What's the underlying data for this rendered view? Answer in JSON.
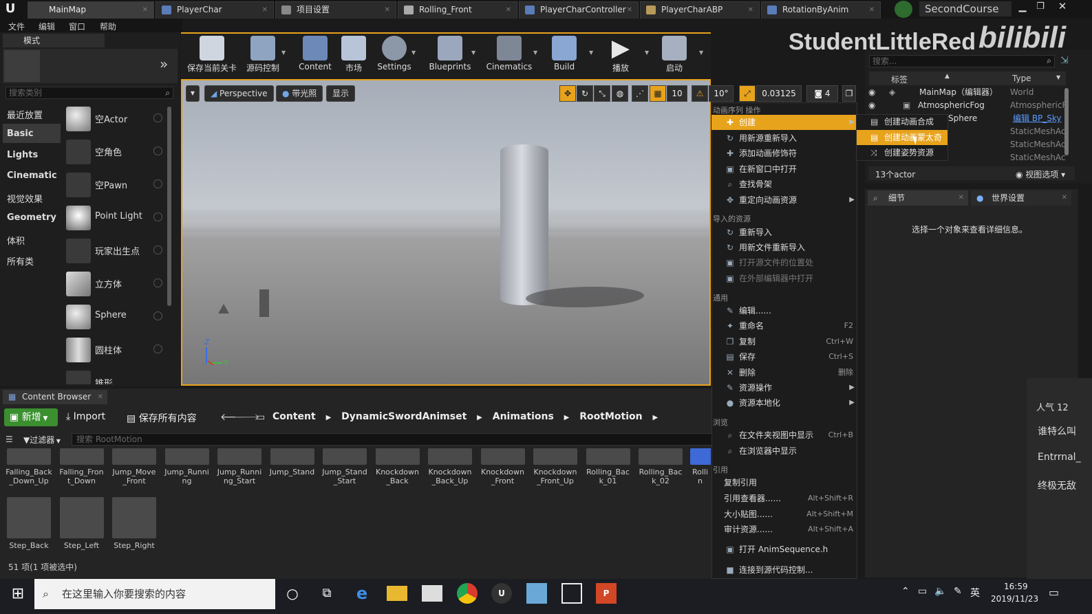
{
  "titlebar": {
    "tabs": [
      {
        "label": "MainMap"
      },
      {
        "label": "PlayerChar"
      },
      {
        "label": "项目设置"
      },
      {
        "label": "Rolling_Front"
      },
      {
        "label": "PlayerCharController"
      },
      {
        "label": "PlayerCharABP"
      },
      {
        "label": "RotationByAnim"
      }
    ],
    "project": "SecondCourse"
  },
  "menubar": [
    "文件",
    "编辑",
    "窗口",
    "帮助"
  ],
  "modes": {
    "title": "模式",
    "search_placeholder": "搜索类别",
    "categories": [
      "最近放置",
      "Basic",
      "Lights",
      "Cinematic",
      "视觉效果",
      "Geometry",
      "体积",
      "所有类"
    ],
    "actors": [
      "空Actor",
      "空角色",
      "空Pawn",
      "Point Light",
      "玩家出生点",
      "立方体",
      "Sphere",
      "圆柱体",
      "锥形"
    ]
  },
  "toolbar": {
    "buttons": [
      "保存当前关卡",
      "源码控制",
      "Content",
      "市场",
      "Settings",
      "Blueprints",
      "Cinematics",
      "Build",
      "播放",
      "启动"
    ]
  },
  "watermark": {
    "text": "StudentLittleRed",
    "logo": "bilibili"
  },
  "viewport": {
    "perspective": "Perspective",
    "lit": "带光照",
    "show": "显示",
    "grid_snap": "10",
    "rot_snap": "10°",
    "scale_snap": "0.03125",
    "cam_speed": "4",
    "axis_z": "Z",
    "axis_y": "Y"
  },
  "context_menu": {
    "sections": {
      "anim": "动画序列 操作",
      "imported": "导入的资源",
      "common": "通用",
      "browse": "浏览",
      "refs": "引用"
    },
    "items": [
      {
        "label": "创建",
        "icon": "✚",
        "arrow": "▶"
      },
      {
        "label": "用新源重新导入",
        "icon": "↻"
      },
      {
        "label": "添加动画修饰符",
        "icon": "✚"
      },
      {
        "label": "在新窗口中打开",
        "icon": "▣"
      },
      {
        "label": "查找骨架",
        "icon": "⌕"
      },
      {
        "label": "重定向动画资源",
        "icon": "✥",
        "arrow": "▶"
      },
      {
        "label": "重新导入",
        "icon": "↻"
      },
      {
        "label": "用新文件重新导入",
        "icon": "↻"
      },
      {
        "label": "打开源文件的位置处",
        "icon": "▣"
      },
      {
        "label": "在外部编辑器中打开",
        "icon": "▣"
      },
      {
        "label": "编辑......",
        "icon": "✎"
      },
      {
        "label": "重命名",
        "icon": "✦",
        "shortcut": "F2"
      },
      {
        "label": "复制",
        "icon": "❐",
        "shortcut": "Ctrl+W"
      },
      {
        "label": "保存",
        "icon": "▤",
        "shortcut": "Ctrl+S"
      },
      {
        "label": "删除",
        "icon": "✕",
        "shortcut": "删除"
      },
      {
        "label": "资源操作",
        "icon": "✎",
        "arrow": "▶"
      },
      {
        "label": "资源本地化",
        "icon": "●",
        "arrow": "▶"
      },
      {
        "label": "在文件夹视图中显示",
        "icon": "⌕",
        "shortcut": "Ctrl+B"
      },
      {
        "label": "在浏览器中显示",
        "icon": "⌕"
      },
      {
        "label": "复制引用"
      },
      {
        "label": "引用查看器......",
        "shortcut": "Alt+Shift+R"
      },
      {
        "label": "大小贴图......",
        "shortcut": "Alt+Shift+M"
      },
      {
        "label": "审计资源......",
        "shortcut": "Alt+Shift+A"
      },
      {
        "label": "打开 AnimSequence.h",
        "icon": "▣"
      },
      {
        "label": "连接到源代码控制...",
        "icon": "■"
      }
    ],
    "submenu": [
      "创建动画合成",
      "创建动画蒙太奇",
      "创建姿势资源"
    ]
  },
  "outliner": {
    "search_placeholder": "搜索...",
    "col_label": "标签",
    "col_type": "Type",
    "rows": [
      {
        "label": "MainMap（编辑器）",
        "type": "World"
      },
      {
        "label": "AtmosphericFog",
        "type": "AtmosphericF"
      },
      {
        "label": "Sphere",
        "type": "编辑 BP_Sky"
      },
      {
        "label": "",
        "type": "StaticMeshAc"
      },
      {
        "label": "",
        "type": "StaticMeshAc"
      },
      {
        "label": "",
        "type": "StaticMeshAc"
      }
    ],
    "actor_count": "13个actor",
    "view_options": "视图选项"
  },
  "details": {
    "tab_details": "细节",
    "tab_world": "世界设置",
    "empty_text": "选择一个对象来查看详细信息。"
  },
  "danmaku": {
    "popularity": "人气 12",
    "lines": [
      "谁特么叫",
      "Entrrnal_",
      "终极无敌"
    ]
  },
  "content_browser": {
    "tab": "Content Browser",
    "new_btn": "新增",
    "import_btn": "Import",
    "save_all_btn": "保存所有内容",
    "path": [
      "Content",
      "DynamicSwordAnimset",
      "Animations",
      "RootMotion"
    ],
    "filter_btn": "过滤器",
    "search_placeholder": "搜索 RootMotion",
    "assets_row1": [
      "Falling_Back_Down_Up",
      "Falling_Front_Down",
      "Jump_Move_Front",
      "Jump_Running",
      "Jump_Running_Start",
      "Jump_Stand",
      "Jump_Stand_Start",
      "Knockdown_Back",
      "Knockdown_Back_Up",
      "Knockdown_Front",
      "Knockdown_Front_Up",
      "Rolling_Back_01",
      "Rolling_Back_02",
      "Rollin"
    ],
    "assets_row2": [
      "Step_Back",
      "Step_Left",
      "Step_Right"
    ],
    "status": "51 项(1 项被选中)"
  },
  "taskbar": {
    "search_placeholder": "在这里输入你要搜索的内容",
    "time": "16:59",
    "date": "2019/11/23",
    "ime": "英"
  },
  "colors": {
    "accent_orange": "#e8a31c",
    "selection_blue": "#2d67b8",
    "new_btn_green": "#3b8f2f"
  }
}
